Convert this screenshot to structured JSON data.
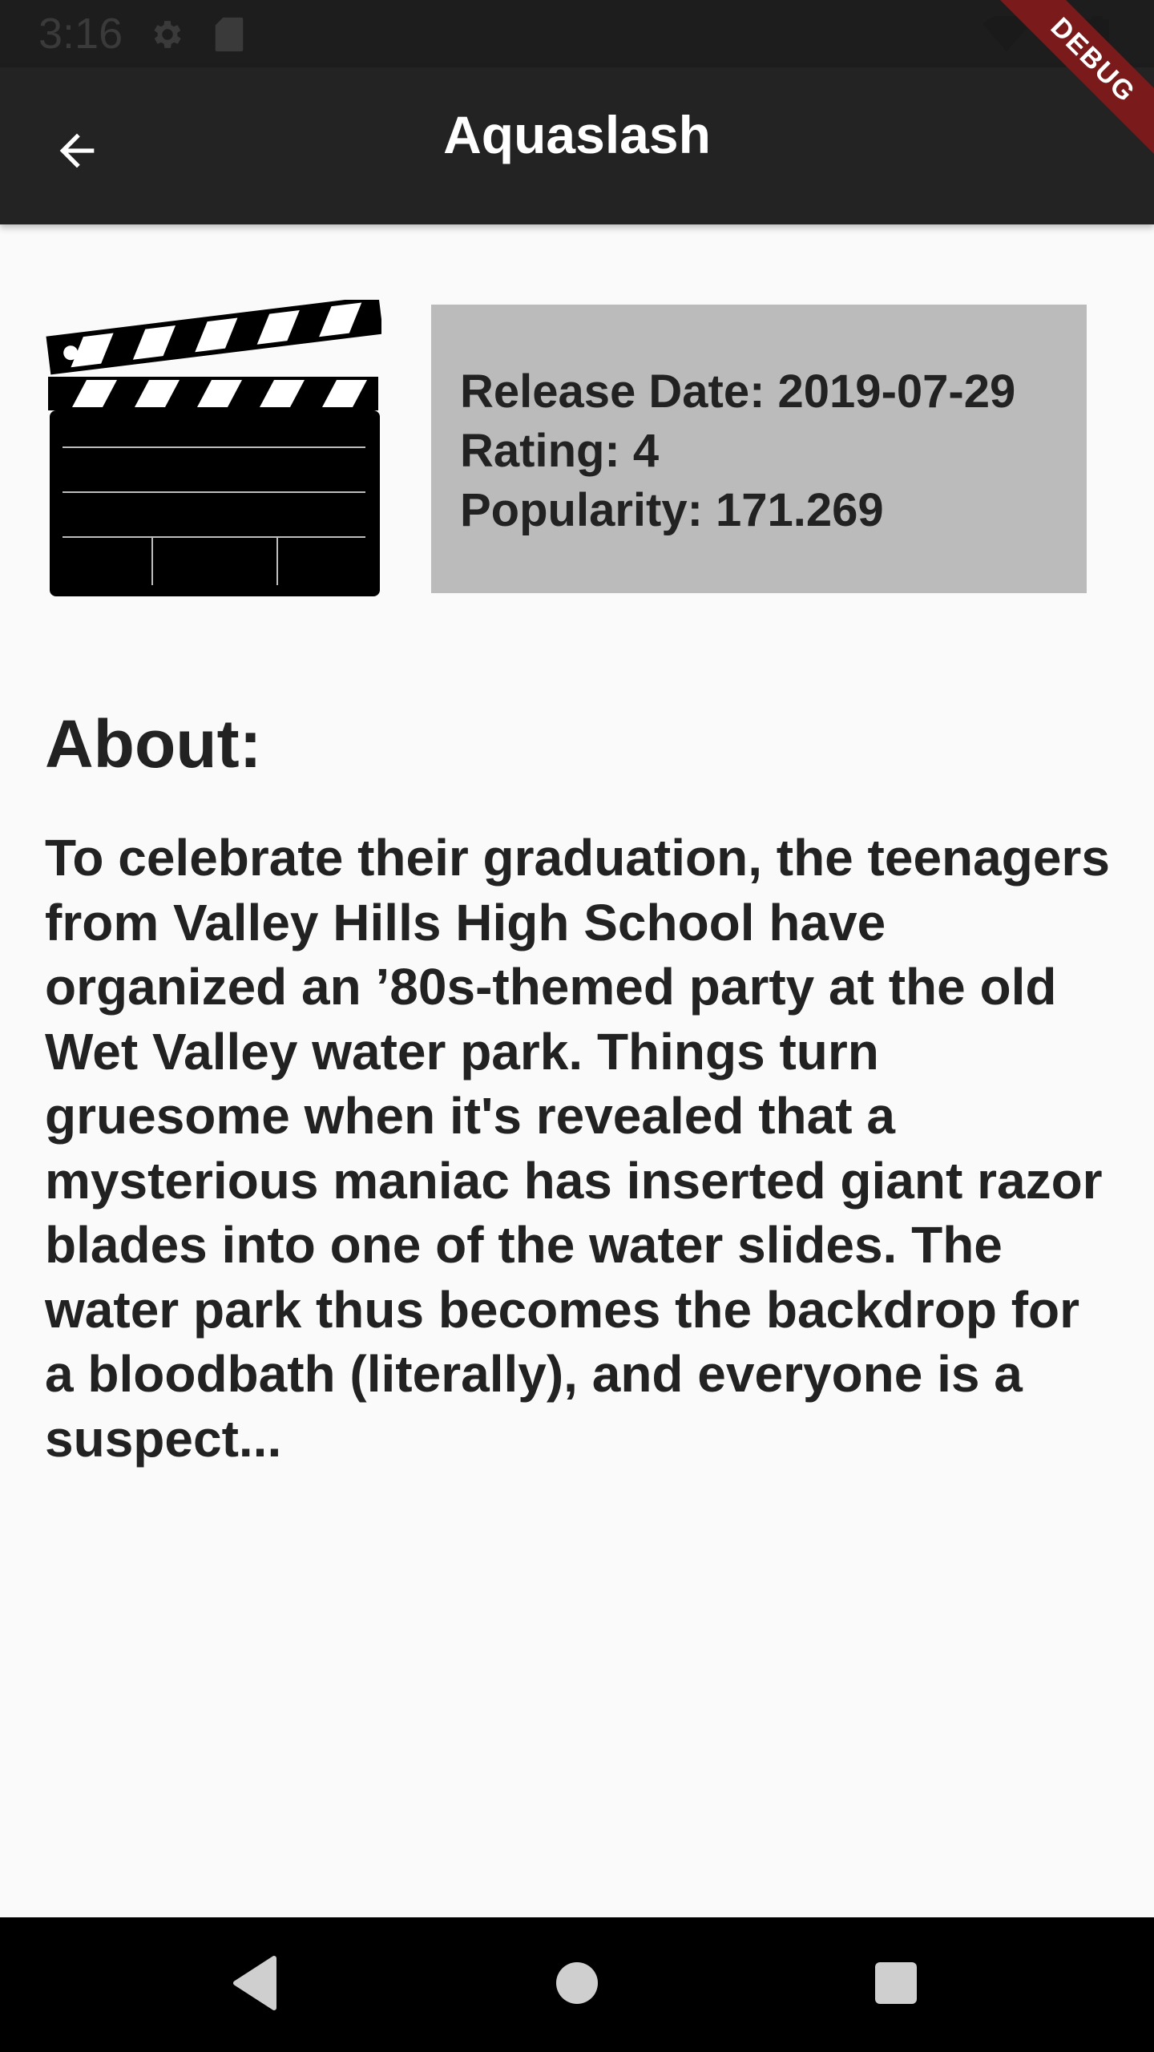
{
  "status_bar": {
    "time": "3:16",
    "icons": [
      "settings-icon",
      "sd-card-icon",
      "wifi-icon",
      "battery-icon"
    ]
  },
  "app_bar": {
    "title": "Aquaslash",
    "back_icon": "arrow-back-icon"
  },
  "debug_banner": "DEBUG",
  "movie": {
    "poster_icon": "clapperboard-icon",
    "release_date": "Release Date: 2019-07-29",
    "rating": "Rating: 4",
    "popularity": "Popularity: 171.269"
  },
  "about": {
    "heading": "About:",
    "text": "To celebrate their graduation, the teenagers from Valley Hills High School have organized an ’80s-themed party at the old Wet Valley water park. Things turn gruesome when it's revealed that a mysterious maniac has inserted giant razor blades into one of the water slides. The water park thus becomes the backdrop for a bloodbath (literally), and everyone is a suspect..."
  },
  "nav_bar": {
    "icons": [
      "nav-back-icon",
      "nav-home-icon",
      "nav-recents-icon"
    ]
  },
  "colors": {
    "app_bar": "#232323",
    "status_bar": "#1d1d1d",
    "info_box": "#bbbbbb",
    "page_background": "#fafafa",
    "debug_banner": "#7a1a1a"
  }
}
